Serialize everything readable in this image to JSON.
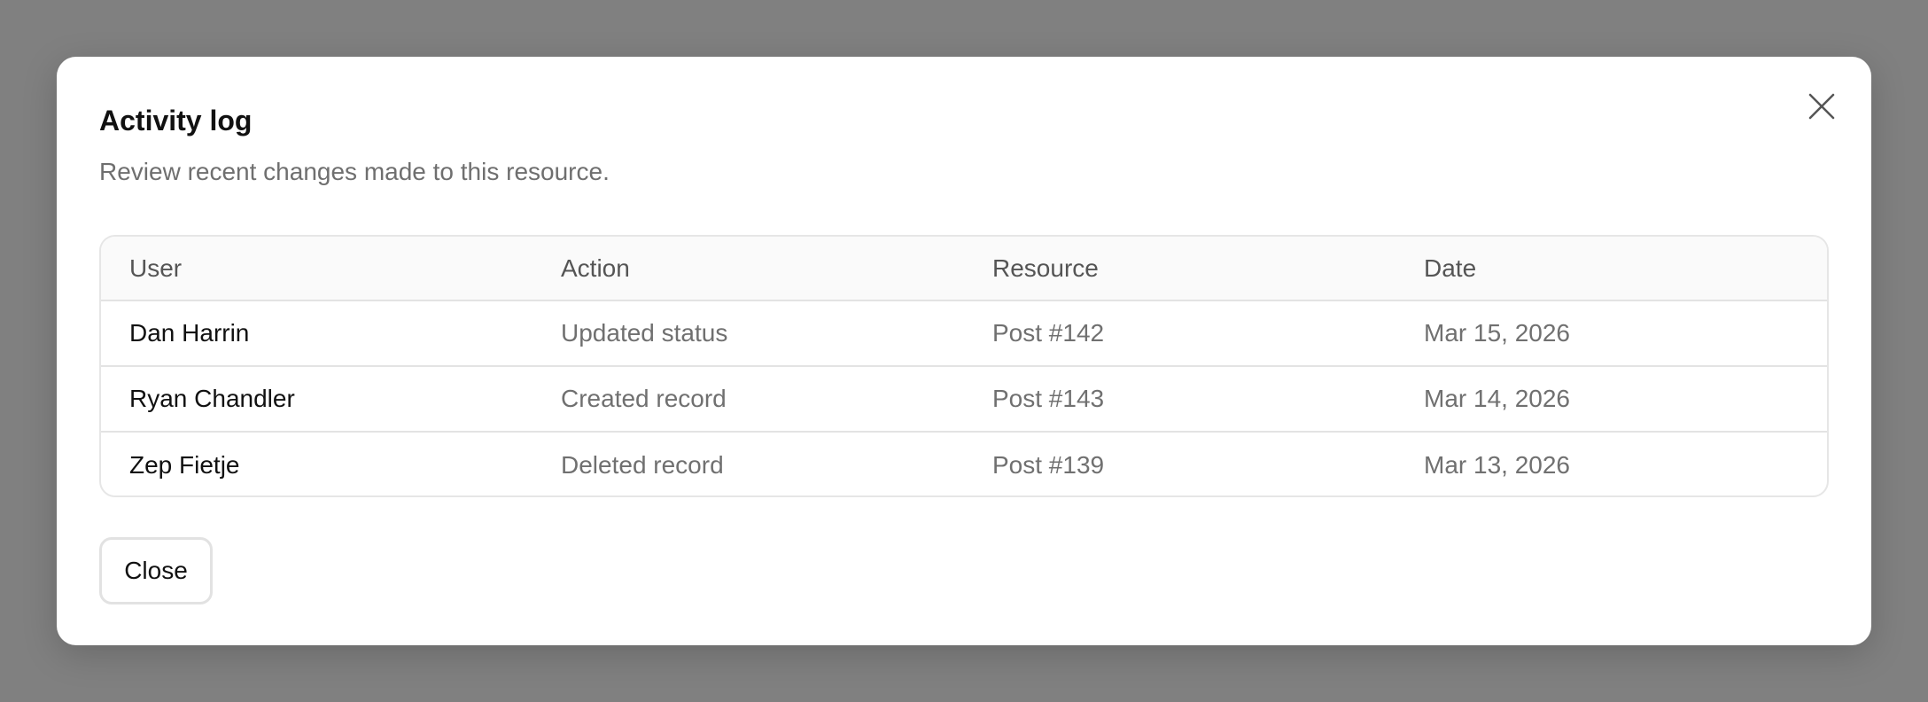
{
  "modal": {
    "title": "Activity log",
    "subtitle": "Review recent changes made to this resource.",
    "close_icon": "close-icon",
    "close_button_label": "Close"
  },
  "table": {
    "columns": [
      "User",
      "Action",
      "Resource",
      "Date"
    ],
    "rows": [
      {
        "user": "Dan Harrin",
        "action": "Updated status",
        "resource": "Post #142",
        "date": "Mar 15, 2026"
      },
      {
        "user": "Ryan Chandler",
        "action": "Created record",
        "resource": "Post #143",
        "date": "Mar 14, 2026"
      },
      {
        "user": "Zep Fietje",
        "action": "Deleted record",
        "resource": "Post #139",
        "date": "Mar 13, 2026"
      }
    ]
  },
  "colors": {
    "backdrop": "#808080",
    "modal_bg": "#ffffff",
    "header_bg": "#fafafa",
    "text_primary": "#111111",
    "text_muted": "#707070",
    "border": "#e6e6e6"
  }
}
